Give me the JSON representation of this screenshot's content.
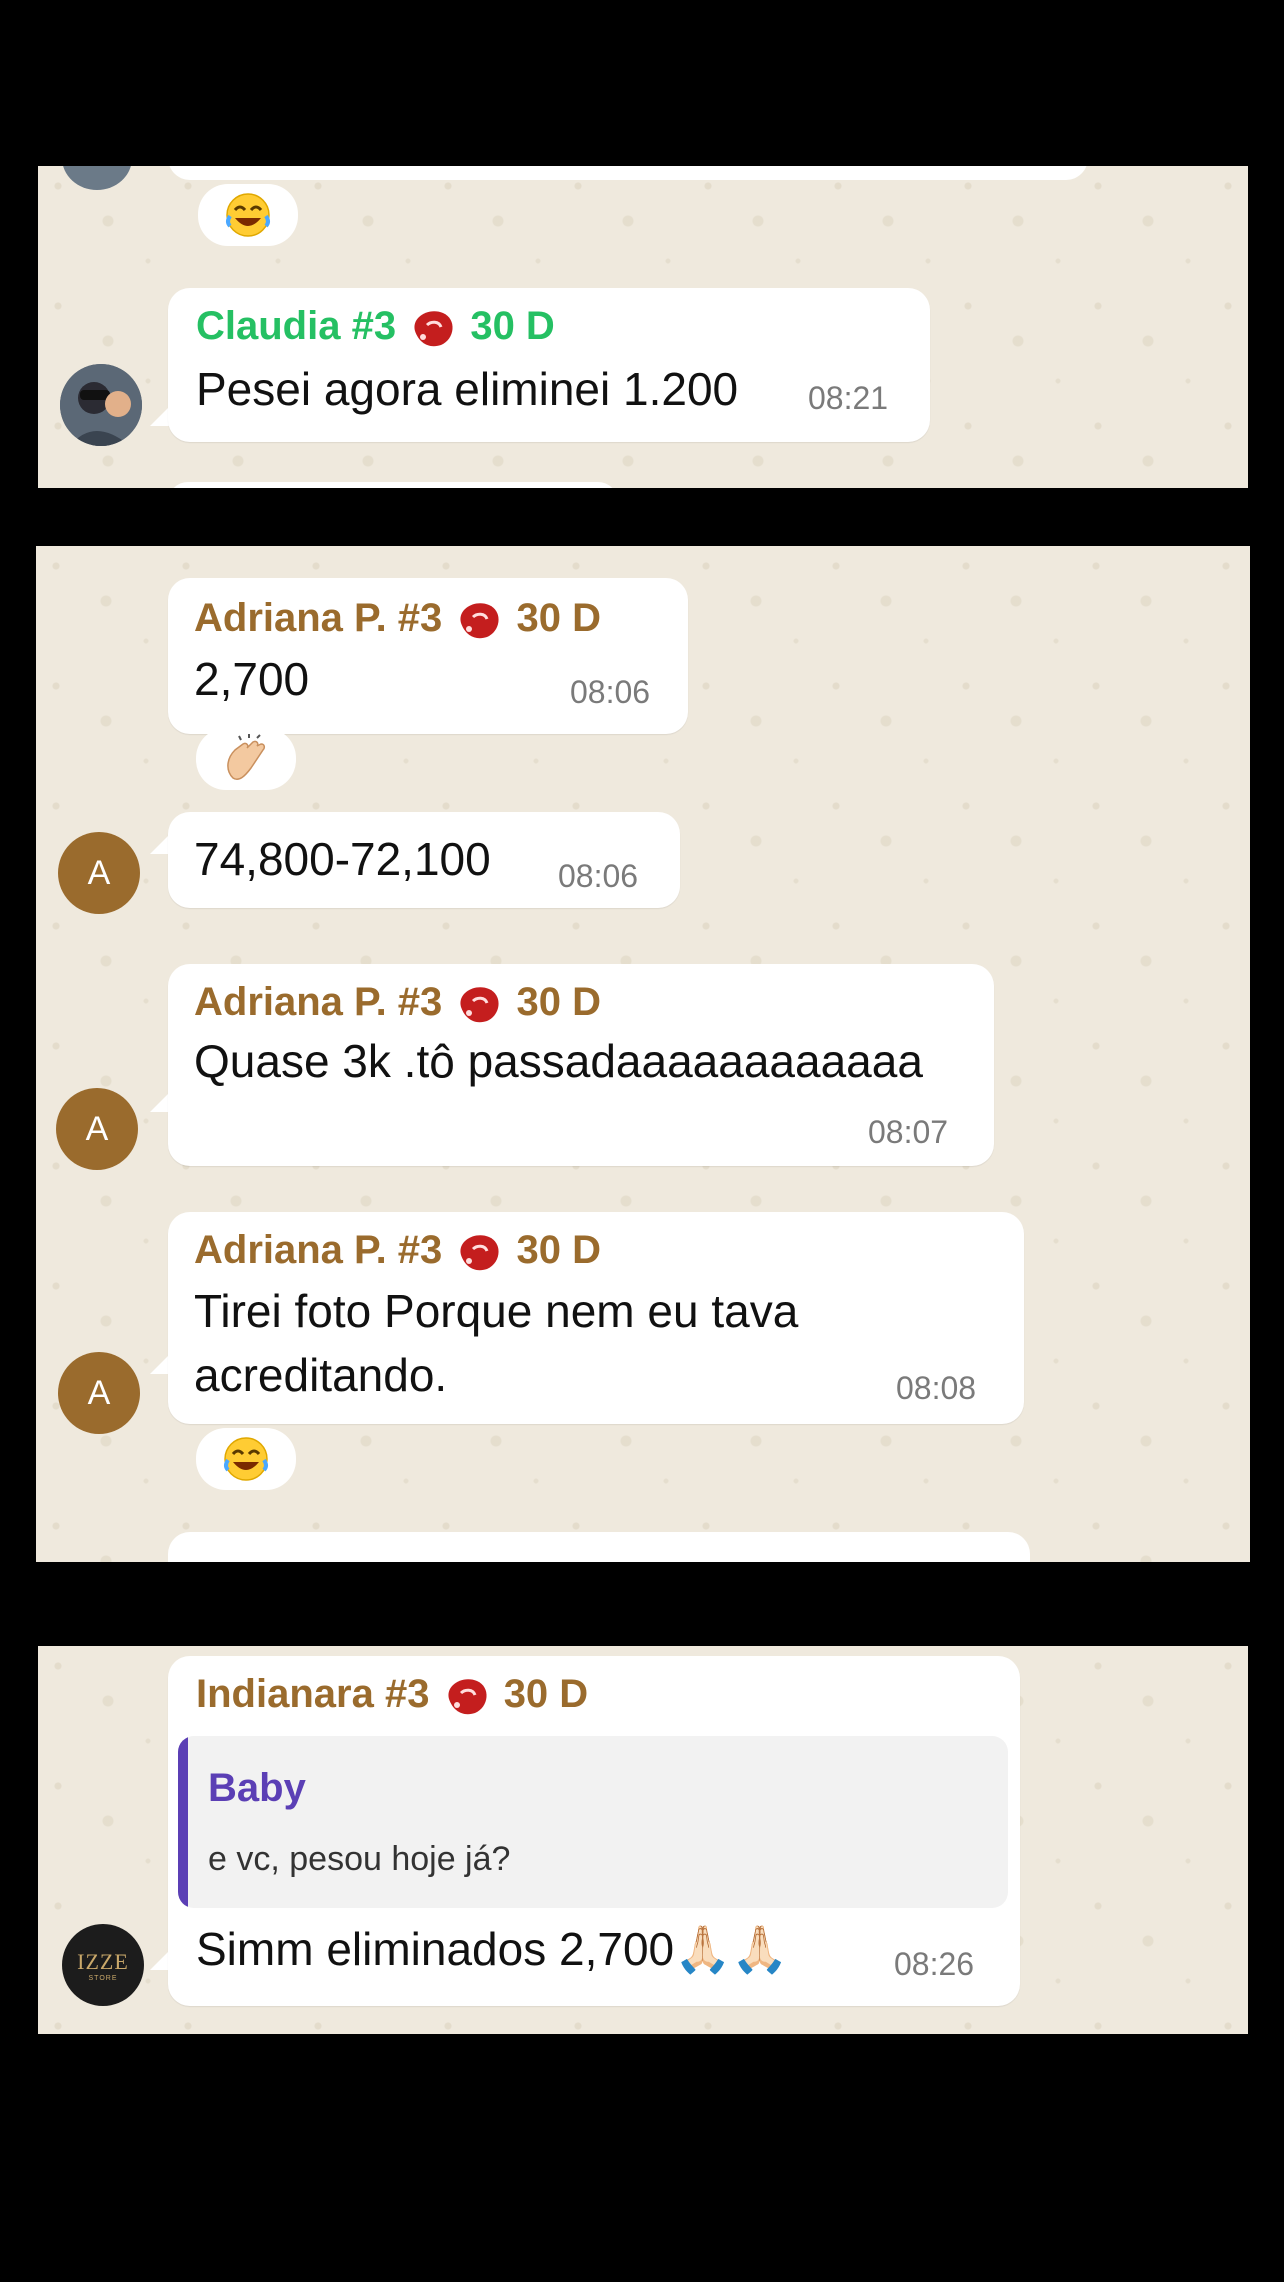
{
  "colors": {
    "claudia_name": "#25c063",
    "adriana_name": "#9a6b2d",
    "indianara_name": "#9a6b2d",
    "quote_name": "#5b3fb5",
    "quote_bar": "#5b3fb5",
    "avatar_a": "#9a6b2d"
  },
  "panel1": {
    "reaction_icon": "laughing-face",
    "msg": {
      "name": "Claudia #3",
      "badge": "30 D",
      "text": "Pesei agora eliminei 1.200",
      "time": "08:21"
    }
  },
  "panel2": {
    "msg1": {
      "name": "Adriana P.  #3",
      "badge": "30 D",
      "text": "2,700",
      "time": "08:06"
    },
    "reaction1_icon": "clapping-hands",
    "msg2": {
      "text": "74,800-72,100",
      "time": "08:06",
      "avatar_letter": "A"
    },
    "msg3": {
      "name": "Adriana P.  #3",
      "badge": "30 D",
      "text": "Quase 3k .tô passadaaaaaaaaaaaa",
      "time": "08:07",
      "avatar_letter": "A"
    },
    "msg4": {
      "name": "Adriana P.  #3",
      "badge": "30 D",
      "text_line1": "Tirei foto Porque nem eu tava",
      "text_line2": "acreditando.",
      "time": "08:08",
      "avatar_letter": "A"
    },
    "reaction2_icon": "laughing-face"
  },
  "panel3": {
    "msg": {
      "name": "Indianara #3",
      "badge": "30 D",
      "quote_author": "Baby",
      "quote_text": "e vc, pesou hoje já?",
      "text": "Simm eliminados  2,700🙏🏻🙏🏻",
      "time": "08:26",
      "avatar_text": "IZZE",
      "avatar_subtext": "STORE"
    }
  }
}
